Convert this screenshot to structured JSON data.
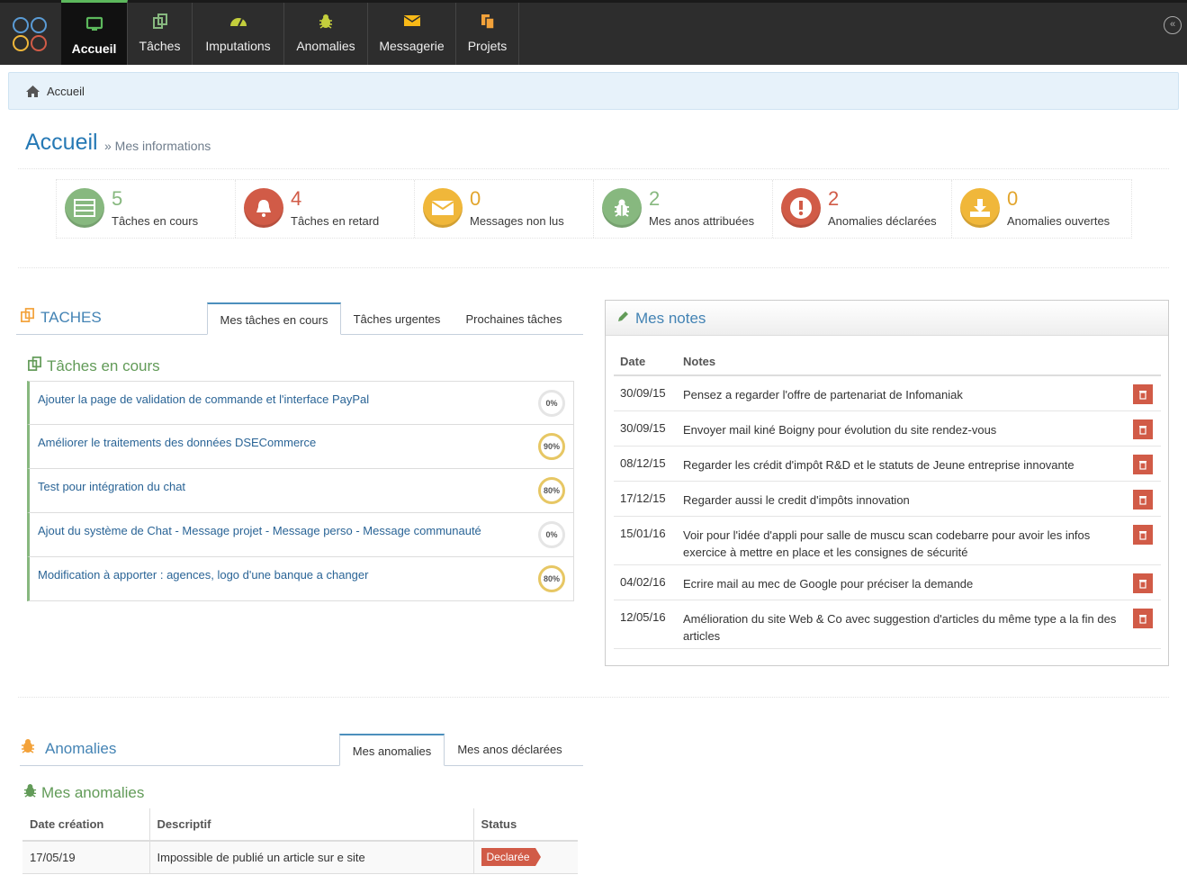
{
  "nav": {
    "items": [
      {
        "label": "Accueil",
        "icon": "monitor-icon",
        "color": "#5cb85c"
      },
      {
        "label": "Tâches",
        "icon": "copy-icon",
        "color": "#87b87f"
      },
      {
        "label": "Imputations",
        "icon": "dashboard-icon",
        "color": "#c3ce3c"
      },
      {
        "label": "Anomalies",
        "icon": "bug-icon",
        "color": "#c3ce3c"
      },
      {
        "label": "Messagerie",
        "icon": "envelope-icon",
        "color": "#f8b917"
      },
      {
        "label": "Projets",
        "icon": "files-icon",
        "color": "#f3a23a"
      }
    ],
    "collapse": "«"
  },
  "breadcrumb": {
    "label": "Accueil"
  },
  "page": {
    "title": "Accueil",
    "subtitle": "» Mes informations"
  },
  "stats": [
    {
      "value": "5",
      "label": "Tâches en cours",
      "color": "#87b87f",
      "numcolor": "#87b87f",
      "icon": "list-icon"
    },
    {
      "value": "4",
      "label": "Tâches en retard",
      "color": "#d15b47",
      "numcolor": "#d15b47",
      "icon": "bell-icon"
    },
    {
      "value": "0",
      "label": "Messages non lus",
      "color": "#f0b73a",
      "numcolor": "#e2a52c",
      "icon": "envelope-icon"
    },
    {
      "value": "2",
      "label": "Mes anos attribuées",
      "color": "#87b87f",
      "numcolor": "#87b87f",
      "icon": "bug-icon"
    },
    {
      "value": "2",
      "label": "Anomalies déclarées",
      "color": "#d15b47",
      "numcolor": "#d15b47",
      "icon": "exclamation-icon"
    },
    {
      "value": "0",
      "label": "Anomalies ouvertes",
      "color": "#f0b73a",
      "numcolor": "#e2a52c",
      "icon": "download-icon"
    }
  ],
  "taches": {
    "title": "TACHES",
    "tabs": [
      "Mes tâches en cours",
      "Tâches urgentes",
      "Prochaines tâches"
    ],
    "subtitle": "Tâches en cours",
    "items": [
      {
        "text": "Ajouter la page de validation de commande et l'interface PayPal",
        "pct": "0%",
        "progress": 0
      },
      {
        "text": "Améliorer le traitements des données DSECommerce",
        "pct": "90%",
        "progress": 90
      },
      {
        "text": "Test pour intégration du chat",
        "pct": "80%",
        "progress": 80
      },
      {
        "text": "Ajout du système de Chat - Message projet - Message perso - Message communauté",
        "pct": "0%",
        "progress": 0
      },
      {
        "text": "Modification à apporter : agences, logo d'une banque a changer",
        "pct": "80%",
        "progress": 80
      }
    ]
  },
  "notes": {
    "title": "Mes notes",
    "col_date": "Date",
    "col_notes": "Notes",
    "rows": [
      {
        "date": "30/09/15",
        "text": "Pensez a regarder l'offre de partenariat de Infomaniak"
      },
      {
        "date": "30/09/15",
        "text": "Envoyer mail kiné Boigny pour évolution du site rendez-vous"
      },
      {
        "date": "08/12/15",
        "text": "Regarder les crédit d'impôt R&D et le statuts de Jeune entreprise innovante"
      },
      {
        "date": "17/12/15",
        "text": "Regarder aussi le credit d'impôts innovation"
      },
      {
        "date": "15/01/16",
        "text": "Voir pour l'idée d'appli pour salle de muscu scan codebarre pour avoir les infos exercice à mettre en place et les consignes de sécurité"
      },
      {
        "date": "04/02/16",
        "text": "Ecrire mail au mec de Google pour préciser la demande"
      },
      {
        "date": "12/05/16",
        "text": "Amélioration du site Web & Co avec suggestion d'articles du même type a la fin des articles"
      }
    ]
  },
  "anomalies": {
    "title": "Anomalies",
    "tabs": [
      "Mes anomalies",
      "Mes anos déclarées"
    ],
    "subtitle": "Mes anomalies",
    "headers": [
      "Date création",
      "Descriptif",
      "Status"
    ],
    "rows": [
      {
        "date": "17/05/19",
        "desc": "Impossible de publié un article sur e site",
        "status": "Declarée"
      }
    ]
  }
}
